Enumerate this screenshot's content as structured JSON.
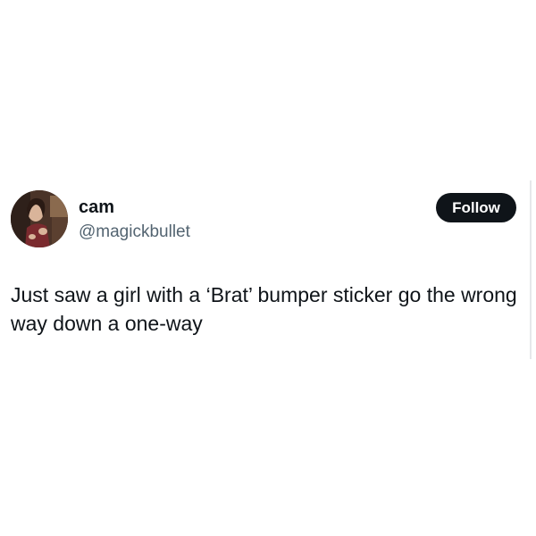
{
  "author": {
    "display_name": "cam",
    "handle": "@magickbullet",
    "avatar_icon": "profile-photo"
  },
  "follow_button": {
    "label": "Follow"
  },
  "tweet": {
    "text": "Just saw a girl with a ‘Brat’ bumper sticker go the wrong way down a one-way"
  },
  "colors": {
    "text_primary": "#0f1419",
    "text_secondary": "#536471",
    "button_bg": "#0f1419",
    "button_text": "#ffffff",
    "background": "#ffffff"
  }
}
